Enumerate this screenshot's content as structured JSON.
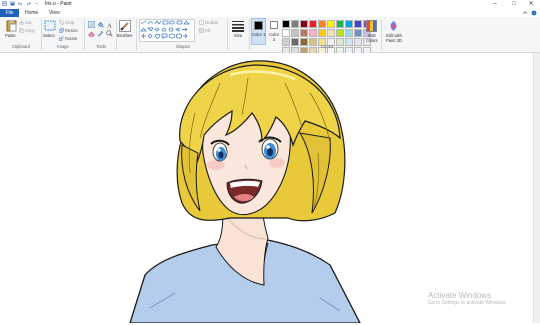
{
  "window": {
    "title": "Iris.o - Paint",
    "controls": [
      "–",
      "□",
      "✕"
    ]
  },
  "tabs": {
    "file": "File",
    "home": "Home",
    "view": "View"
  },
  "ribbon": {
    "clipboard": {
      "paste": "Paste",
      "cut": "Cut",
      "copy": "Copy",
      "group_label": "Clipboard"
    },
    "image": {
      "select": "Select",
      "crop": "Crop",
      "resize": "Resize",
      "rotate": "Rotate",
      "group_label": "Image"
    },
    "tools": {
      "group_label": "Tools"
    },
    "brushes": {
      "label": "Brushes"
    },
    "shapes": {
      "outline": "Outline",
      "fill": "Fill",
      "group_label": "Shapes"
    },
    "size": {
      "label": "Size"
    },
    "color1": {
      "label": "Color 1",
      "value": "#000000"
    },
    "color2": {
      "label": "Color 2",
      "value": "#ffffff"
    },
    "colors": {
      "group_label": "Colors",
      "palette": [
        "#000000",
        "#7f7f7f",
        "#880015",
        "#ed1c24",
        "#ff7f27",
        "#fff200",
        "#22b14c",
        "#00a2e8",
        "#3f48cc",
        "#a349a4",
        "#ffffff",
        "#c3c3c3",
        "#b97a57",
        "#ffaec9",
        "#ffc90e",
        "#efe4b0",
        "#b5e61d",
        "#99d9ea",
        "#7092be",
        "#c8bfe7",
        "#cfcfcf",
        "#6b6b6b",
        "#8a6a2f",
        "#d8c08a",
        "#f3e08a",
        "#f0f0f0",
        "#d8ecd0",
        "#cfe6f4",
        "#dfe6f1",
        "#ece8f4",
        "#e7e7e7",
        "#dcdcdc",
        "#c0a070",
        "#e6d6b0",
        "#f7f0c8",
        "#f6f6f6",
        "#e8f4e6",
        "#e6f2fa",
        "#eef2f8",
        "#f4f2f8"
      ],
      "edit_colors": "Edit colors",
      "edit_paint3d": "Edit with Paint 3D"
    }
  },
  "watermark": {
    "title": "Activate Windows",
    "subtitle": "Go to Settings to activate Windows."
  }
}
